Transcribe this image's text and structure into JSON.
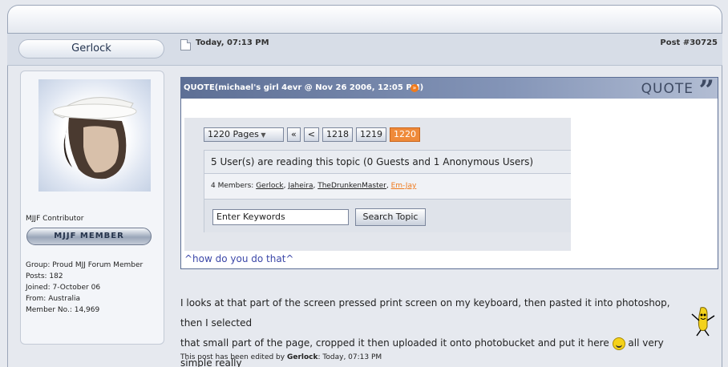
{
  "post": {
    "author": "Gerlock",
    "date": "Today, 07:13 PM",
    "post_number": "Post #30725"
  },
  "profile": {
    "rank_title": "MJJF Contributor",
    "member_badge": "MJJF MEMBER",
    "info": [
      "Group: Proud MJJ Forum Member",
      "Posts: 182",
      "Joined: 7-October 06",
      "From: Australia",
      "Member No.: 14,969"
    ]
  },
  "quote": {
    "header": "QUOTE(michael's girl 4evr @ Nov 26 2006, 12:05 PM)",
    "label": "QUOTE",
    "pager": {
      "pages": "1220 Pages",
      "first": "«",
      "prev": "<",
      "page_a": "1218",
      "page_b": "1219",
      "current": "1220"
    },
    "readers": "5 User(s) are reading this topic (0 Guests and 1 Anonymous Users)",
    "members_prefix": "4 Members:",
    "members": [
      "Gerlock",
      "Jaheira",
      "TheDrunkenMaster",
      "Em-Jay"
    ],
    "search_placeholder": "Enter Keywords",
    "search_button": "Search Topic",
    "caption": "^how do you do that^"
  },
  "body": {
    "line1": "I looks at that part of the screen pressed print screen on my keyboard, then pasted it into photoshop, then I selected",
    "line2_a": "that small part of the page, cropped it then uploaded it onto photobucket and put it here",
    "line2_b": "all very simple really"
  },
  "edited": {
    "prefix": "This post has been edited by",
    "user": "Gerlock",
    "suffix": ": Today, 07:13 PM"
  },
  "icons": {
    "post": "post-icon",
    "quote_link": "view-post-icon",
    "smiley": "grin-smiley-icon",
    "banana": "dancing-banana-icon"
  }
}
